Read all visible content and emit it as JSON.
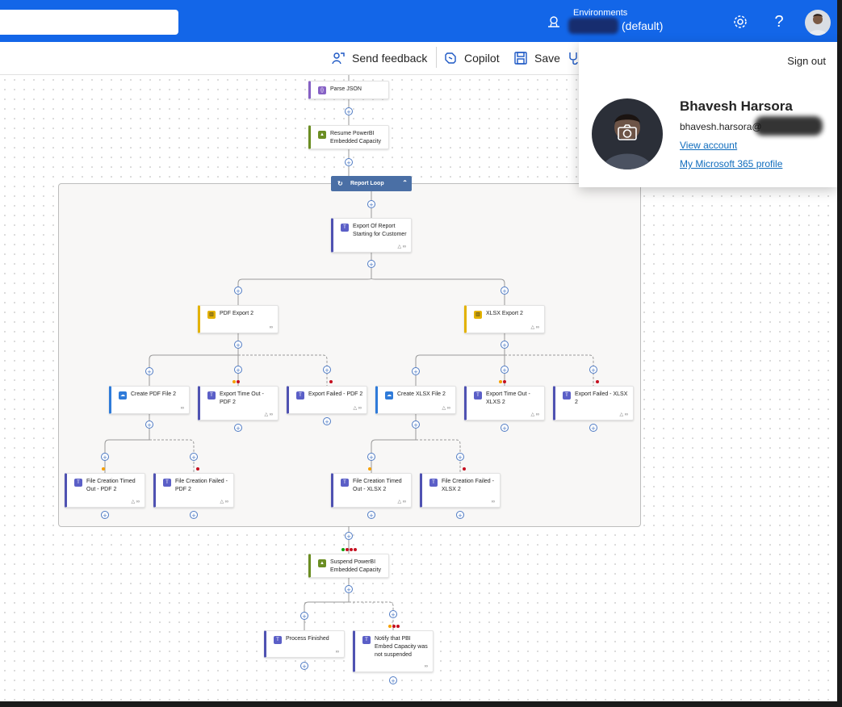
{
  "header": {
    "environment_label": "Environments",
    "environment_value": "(default)",
    "settings_icon": "gear-icon",
    "help_label": "?"
  },
  "toolbar": {
    "send_feedback": "Send feedback",
    "copilot": "Copilot",
    "save": "Save"
  },
  "profile": {
    "sign_out": "Sign out",
    "name": "Bhavesh Harsora",
    "email": "bhavesh.harsora@",
    "view_account": "View account",
    "m365_profile": "My Microsoft 365 profile"
  },
  "flow": {
    "scope_title": "Report Loop",
    "nodes": {
      "parse_json": "Parse JSON",
      "resume": "Resume PowerBI Embedded Capacity",
      "export_start": "Export Of Report Starting for Customer",
      "pdf_export": "PDF Export 2",
      "xlsx_export": "XLSX Export 2",
      "create_pdf": "Create PDF File 2",
      "export_timeout_pdf": "Export Time Out - PDF 2",
      "export_failed_pdf": "Export Failed - PDF 2",
      "create_xlsx": "Create XLSX File 2",
      "export_timeout_xlxs": "Export Time Out - XLXS 2",
      "export_failed_xlsx": "Export Failed - XLSX 2",
      "file_timeout_pdf": "File Creation Timed Out - PDF 2",
      "file_failed_pdf": "File Creation Failed - PDF 2",
      "file_timeout_xlsx": "File Creation Timed Out - XLSX 2",
      "file_failed_xlsx": "File Creation Failed - XLSX 2",
      "suspend": "Suspend PowerBI Embedded Capacity",
      "process_finished": "Process Finished",
      "notify": "Notify that PBI Embed Capacity was not suspended"
    }
  },
  "colors": {
    "header_blue": "#1366e8",
    "teams_purple": "#4f52b2",
    "success_green": "#13a10e",
    "warning_orange": "#f7a000",
    "failed_red": "#c50f1f"
  }
}
